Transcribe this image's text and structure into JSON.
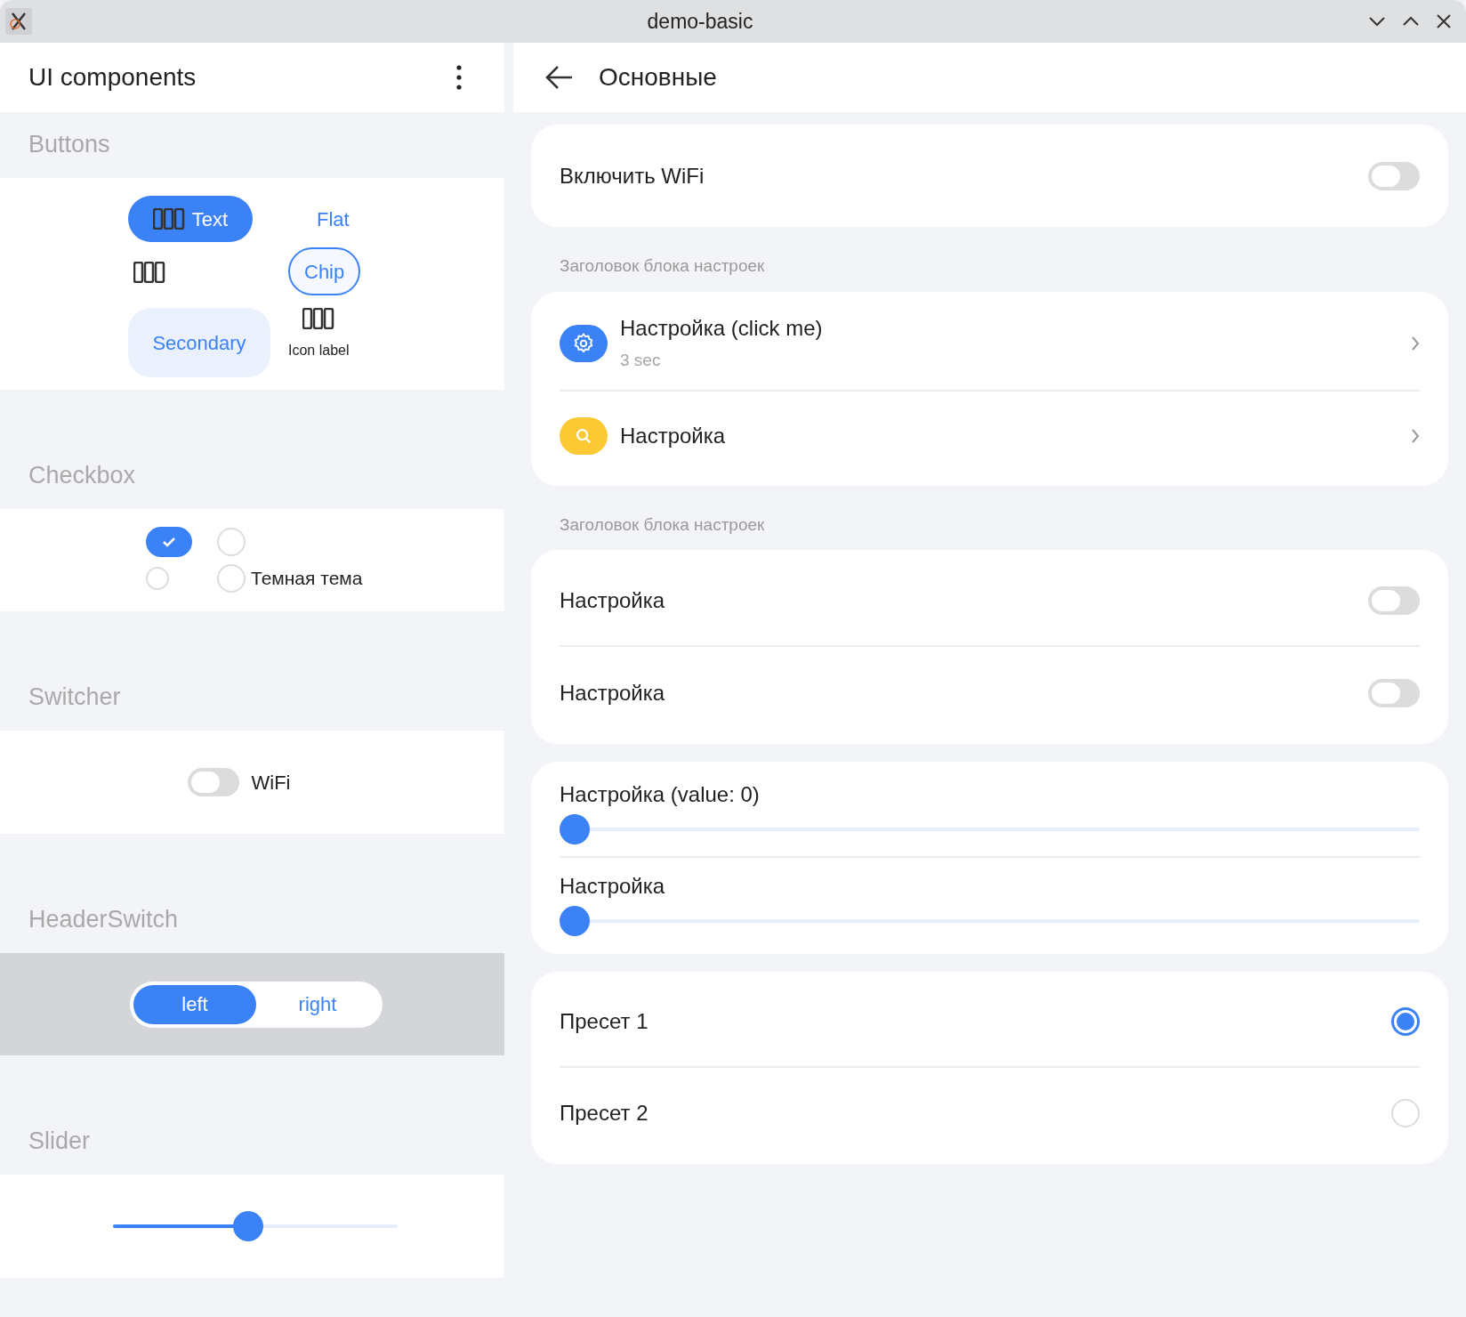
{
  "window": {
    "title": "demo-basic"
  },
  "left": {
    "title": "UI components",
    "sections": [
      {
        "kind": "buttons",
        "title": "Buttons",
        "items": [
          {
            "kind": "primary",
            "label": "Text"
          },
          {
            "kind": "flat",
            "label": "Flat"
          },
          {
            "kind": "icon"
          },
          {
            "kind": "chip",
            "label": "Chip"
          },
          {
            "kind": "secondary",
            "label": "Secondary"
          },
          {
            "kind": "icon_label",
            "label": "Icon label"
          }
        ]
      },
      {
        "kind": "checkbox",
        "title": "Checkbox",
        "items": [
          {
            "checked": true
          },
          {
            "checked": false
          },
          {
            "checked": false
          },
          {
            "checked": false,
            "label": "Темная тема"
          }
        ]
      },
      {
        "kind": "switcher",
        "title": "Switcher",
        "on": false,
        "label": "WiFi"
      },
      {
        "kind": "headerswitch",
        "title": "HeaderSwitch",
        "options": [
          {
            "label": "left",
            "selected": true
          },
          {
            "label": "right",
            "selected": false
          }
        ]
      },
      {
        "kind": "slider",
        "title": "Slider",
        "level": 0.5
      }
    ]
  },
  "right": {
    "title": "Основные",
    "groups": [
      {
        "rows": [
          {
            "kind": "switch",
            "label": "Включить WiFi",
            "on": false
          }
        ]
      },
      {
        "header": "Заголовок блока настроек",
        "rows": [
          {
            "kind": "link",
            "label": "Настройка (click me)",
            "subtitle": "3 sec",
            "color": "#3b82f6"
          },
          {
            "kind": "link",
            "label": "Настройка",
            "color": "#fcc934"
          }
        ]
      },
      {
        "header": "Заголовок блока настроек",
        "rows": [
          {
            "kind": "switch",
            "label": "Настройка",
            "on": false
          },
          {
            "kind": "switch",
            "label": "Настройка",
            "on": false
          }
        ]
      },
      {
        "rows": [
          {
            "kind": "slider",
            "label": "Настройка (value: 0)",
            "level": 0
          },
          {
            "kind": "slider",
            "label": "Настройка",
            "level": 0
          }
        ]
      },
      {
        "rows": [
          {
            "kind": "radio",
            "label": "Пресет 1",
            "selected": true
          },
          {
            "kind": "radio",
            "label": "Пресет 2",
            "selected": false
          }
        ]
      }
    ]
  }
}
